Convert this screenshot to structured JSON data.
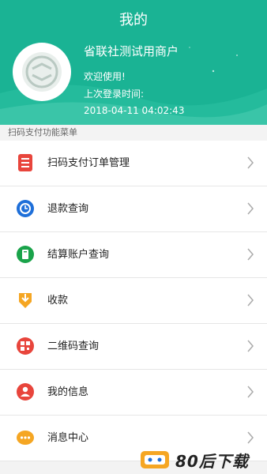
{
  "header": {
    "title": "我的",
    "merchant_name": "省联社测试用商户",
    "welcome": "欢迎使用!",
    "last_login_label": "上次登录时间:",
    "last_login_time": "2018-04-11 04:02:43"
  },
  "section_label": "扫码支付功能菜单",
  "menu": {
    "items": [
      {
        "label": "扫码支付订单管理",
        "icon": "order-list-icon",
        "color": "#e8453c"
      },
      {
        "label": "退款查询",
        "icon": "refund-icon",
        "color": "#1e6fd9"
      },
      {
        "label": "结算账户查询",
        "icon": "account-icon",
        "color": "#1aa34a"
      },
      {
        "label": "收款",
        "icon": "receive-payment-icon",
        "color": "#f5a623"
      },
      {
        "label": "二维码查询",
        "icon": "qr-code-icon",
        "color": "#e8453c"
      },
      {
        "label": "我的信息",
        "icon": "user-info-icon",
        "color": "#e8453c"
      },
      {
        "label": "消息中心",
        "icon": "message-icon",
        "color": "#f5a623"
      }
    ]
  },
  "watermark": {
    "text": "80后下载"
  },
  "colors": {
    "brand": "#1ab394"
  }
}
